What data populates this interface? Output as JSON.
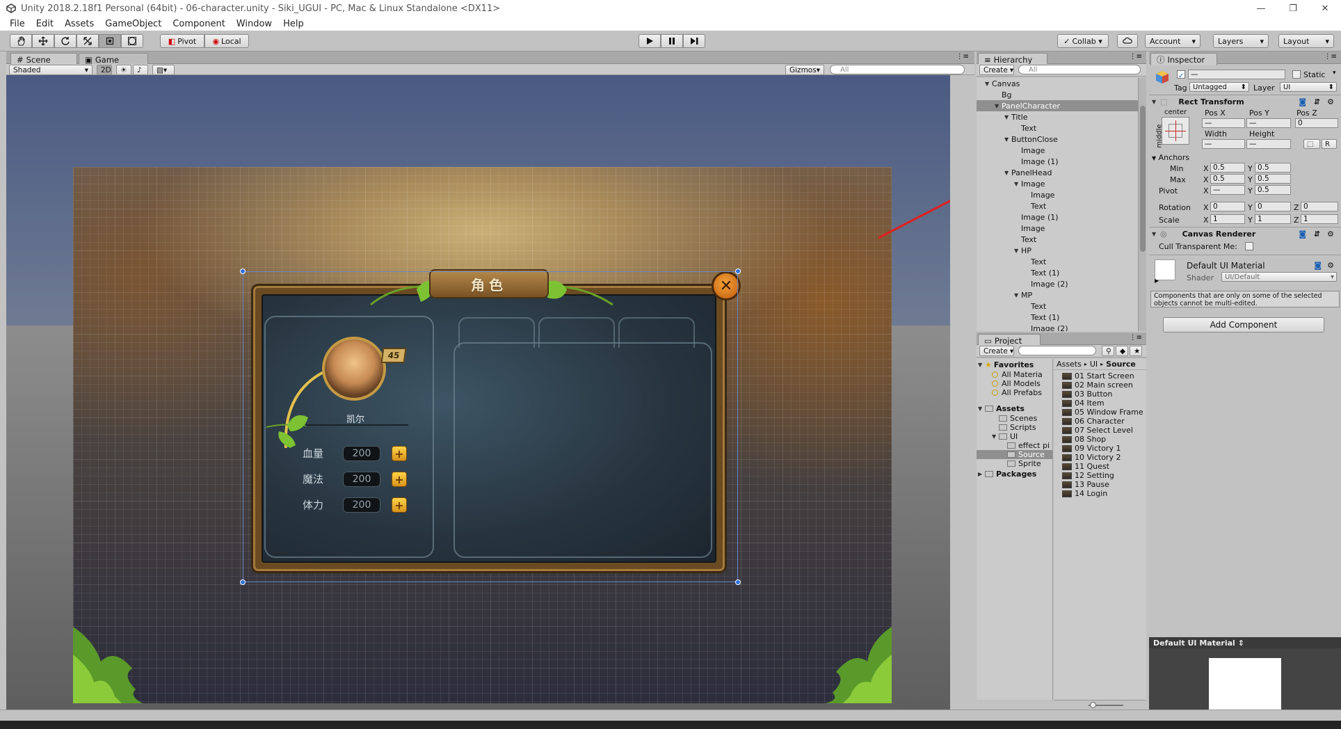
{
  "window": {
    "title": "Unity 2018.2.18f1 Personal (64bit) - 06-character.unity - Siki_UGUI - PC, Mac & Linux Standalone <DX11>",
    "min": "—",
    "max": "❐",
    "close": "✕"
  },
  "menu": [
    "File",
    "Edit",
    "Assets",
    "GameObject",
    "Component",
    "Window",
    "Help"
  ],
  "toolbar": {
    "pivot": "Pivot",
    "local": "Local",
    "collab": "Collab ▾",
    "account": "Account",
    "layers": "Layers",
    "layout": "Layout"
  },
  "scene": {
    "tab_scene": "Scene",
    "tab_game": "Game",
    "shading": "Shaded",
    "mode2d": "2D",
    "gizmos": "Gizmos",
    "search_placeholder": "All"
  },
  "ui": {
    "title": "角色",
    "close": "✕",
    "level": "45",
    "name": "凯尔",
    "stats": [
      {
        "label": "血量",
        "value": "200"
      },
      {
        "label": "魔法",
        "value": "200"
      },
      {
        "label": "体力",
        "value": "200"
      }
    ],
    "plus": "+"
  },
  "hierarchy": {
    "tab": "Hierarchy",
    "create": "Create",
    "search_placeholder": "All",
    "items": [
      {
        "label": "Canvas",
        "depth": 0,
        "exp": "▼"
      },
      {
        "label": "Bg",
        "depth": 1,
        "exp": ""
      },
      {
        "label": "PanelCharacter",
        "depth": 1,
        "exp": "▼",
        "sel": true
      },
      {
        "label": "Title",
        "depth": 2,
        "exp": "▼"
      },
      {
        "label": "Text",
        "depth": 3,
        "exp": ""
      },
      {
        "label": "ButtonClose",
        "depth": 2,
        "exp": "▼"
      },
      {
        "label": "Image",
        "depth": 3,
        "exp": ""
      },
      {
        "label": "Image (1)",
        "depth": 3,
        "exp": ""
      },
      {
        "label": "PanelHead",
        "depth": 2,
        "exp": "▼"
      },
      {
        "label": "Image",
        "depth": 3,
        "exp": "▼"
      },
      {
        "label": "Image",
        "depth": 4,
        "exp": ""
      },
      {
        "label": "Text",
        "depth": 4,
        "exp": ""
      },
      {
        "label": "Image (1)",
        "depth": 3,
        "exp": ""
      },
      {
        "label": "Image",
        "depth": 3,
        "exp": ""
      },
      {
        "label": "Text",
        "depth": 3,
        "exp": ""
      },
      {
        "label": "HP",
        "depth": 3,
        "exp": "▼"
      },
      {
        "label": "Text",
        "depth": 4,
        "exp": ""
      },
      {
        "label": "Text (1)",
        "depth": 4,
        "exp": ""
      },
      {
        "label": "Image (2)",
        "depth": 4,
        "exp": ""
      },
      {
        "label": "MP",
        "depth": 3,
        "exp": "▼"
      },
      {
        "label": "Text",
        "depth": 4,
        "exp": ""
      },
      {
        "label": "Text (1)",
        "depth": 4,
        "exp": ""
      },
      {
        "label": "Image (2)",
        "depth": 4,
        "exp": ""
      }
    ]
  },
  "project": {
    "tab": "Project",
    "create": "Create",
    "favorites": {
      "label": "Favorites",
      "items": [
        "All Materia",
        "All Models",
        "All Prefabs"
      ]
    },
    "assets": {
      "label": "Assets",
      "items": [
        {
          "label": "Scenes",
          "depth": 1
        },
        {
          "label": "Scripts",
          "depth": 1
        },
        {
          "label": "UI",
          "depth": 1
        },
        {
          "label": "effect pi",
          "depth": 2
        },
        {
          "label": "Source",
          "depth": 2,
          "sel": true
        },
        {
          "label": "Sprite",
          "depth": 2
        }
      ]
    },
    "packages": "Packages",
    "breadcrumb": [
      "Assets",
      "UI",
      "Source"
    ],
    "files": [
      "01 Start Screen",
      "02 Main screen",
      "03 Button",
      "04 Item",
      "05 Window Frame",
      "06 Character",
      "07 Select Level",
      "08 Shop",
      "09 Victory 1",
      "10 Victory 2",
      "11 Quest",
      "12 Setting",
      "13 Pause",
      "14 Login"
    ]
  },
  "inspector": {
    "tab": "Inspector",
    "static": "Static",
    "tag_label": "Tag",
    "tag": "Untagged",
    "layer_label": "Layer",
    "layer": "UI",
    "rect": {
      "title": "Rect Transform",
      "anchor_h": "center",
      "anchor_v": "middle",
      "posx": "Pos X",
      "posy": "Pos Y",
      "posz": "Pos Z",
      "posz_val": "0",
      "dash": "—",
      "width": "Width",
      "height": "Height",
      "r": "R",
      "anchors": "Anchors",
      "min": "Min",
      "max": "Max",
      "pivot": "Pivot",
      "x": "X",
      "y": "Y",
      "z": "Z",
      "min_x": "0.5",
      "min_y": "0.5",
      "max_x": "0.5",
      "max_y": "0.5",
      "pivot_y": "0.5",
      "rotation": "Rotation",
      "rot_x": "0",
      "rot_y": "0",
      "rot_z": "0",
      "scale": "Scale",
      "sc_x": "1",
      "sc_y": "1",
      "sc_z": "1"
    },
    "canvas_renderer": "Canvas Renderer",
    "cull": "Cull Transparent Me:",
    "material": "Default UI Material",
    "shader_label": "Shader",
    "shader": "UI/Default",
    "note": "Components that are only on some of the selected objects cannot be multi-edited.",
    "add_component": "Add Component",
    "preview_title": "Default UI Material ⇕"
  }
}
